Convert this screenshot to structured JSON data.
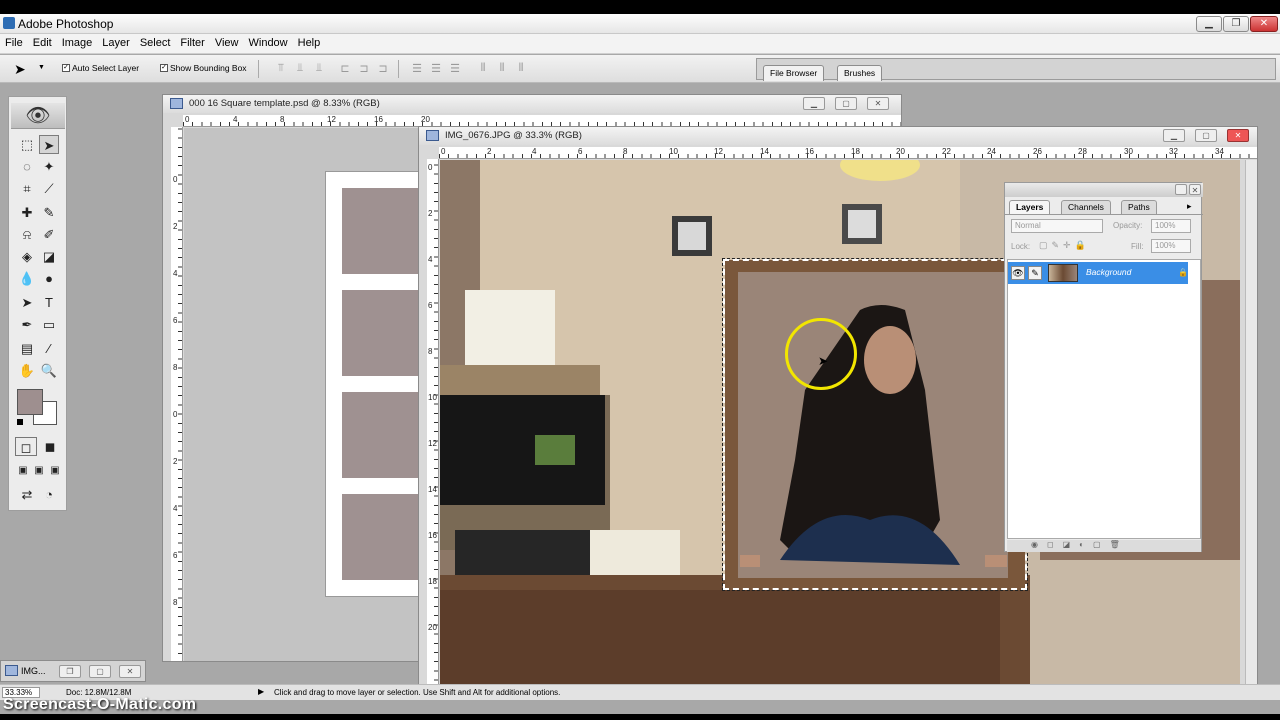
{
  "app": {
    "title": "Adobe Photoshop"
  },
  "menu": [
    "File",
    "Edit",
    "Image",
    "Layer",
    "Select",
    "Filter",
    "View",
    "Window",
    "Help"
  ],
  "options": {
    "auto_select": "Auto Select Layer",
    "show_bounding": "Show Bounding Box"
  },
  "palette_well": {
    "tabs": [
      "File Browser",
      "Brushes"
    ]
  },
  "docs": {
    "template": {
      "title": "000 16 Square template.psd @ 8.33% (RGB)",
      "ruler_h": [
        "0",
        "4",
        "8",
        "12",
        "16",
        "20"
      ],
      "ruler_v": [
        "0",
        "2",
        "4",
        "6",
        "8",
        "0",
        "2",
        "4",
        "6",
        "8"
      ]
    },
    "photo": {
      "title": "IMG_0676.JPG @ 33.3% (RGB)",
      "ruler_h": [
        "0",
        "2",
        "4",
        "6",
        "8",
        "10",
        "12",
        "14",
        "16",
        "18",
        "20",
        "22",
        "24",
        "26",
        "28",
        "30",
        "32",
        "34"
      ],
      "ruler_v": [
        "0",
        "2",
        "4",
        "6",
        "8",
        "10",
        "12",
        "14",
        "16",
        "18",
        "20"
      ]
    }
  },
  "layers_panel": {
    "tabs": [
      "Layers",
      "Channels",
      "Paths"
    ],
    "blend_mode": "Normal",
    "opacity_label": "Opacity:",
    "opacity_value": "100%",
    "lock_label": "Lock:",
    "fill_label": "Fill:",
    "fill_value": "100%",
    "layer_name": "Background"
  },
  "minimized": {
    "label": "IMG..."
  },
  "status": {
    "zoom": "33.33%",
    "doc": "Doc: 12.8M/12.8M",
    "hint": "Click and drag to move layer or selection. Use Shift and Alt for additional options."
  },
  "watermark": "Screencast-O-Matic.com",
  "colors": {
    "accent_selected": "#3a8ee6",
    "foreground_swatch": "#9e8f8f",
    "background_swatch": "#ffffff",
    "placeholder_square": "#9f9191"
  },
  "icons": [
    "move-icon",
    "marquee-icon",
    "lasso-icon",
    "magic-wand-icon",
    "crop-icon",
    "slice-icon",
    "healing-brush-icon",
    "brush-icon",
    "stamp-icon",
    "history-brush-icon",
    "eraser-icon",
    "gradient-icon",
    "blur-icon",
    "dodge-icon",
    "path-select-icon",
    "type-icon",
    "pen-icon",
    "shape-icon",
    "notes-icon",
    "eyedropper-icon",
    "hand-icon",
    "zoom-icon",
    "eye-icon",
    "brush-link-icon"
  ]
}
